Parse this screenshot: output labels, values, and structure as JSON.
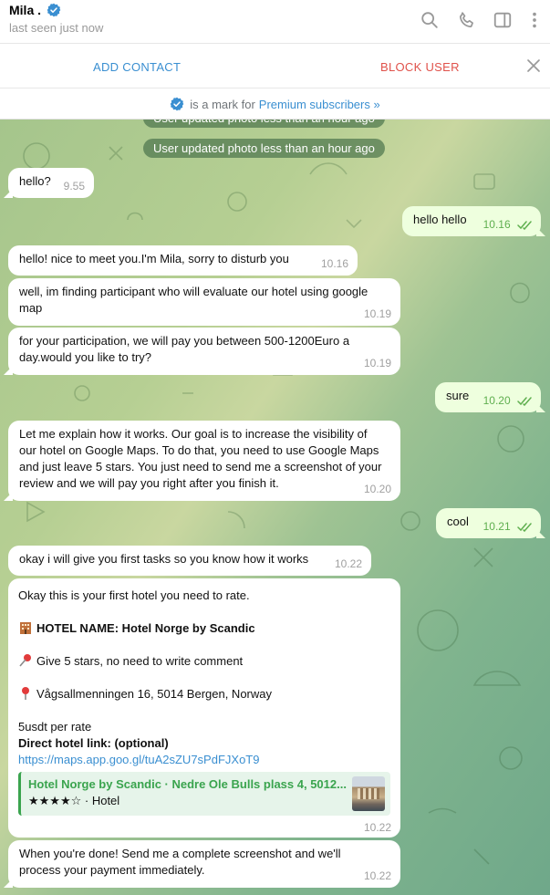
{
  "contact": {
    "name": "Mila .",
    "status": "last seen just now"
  },
  "header_icons": [
    "search-icon",
    "phone-icon",
    "sidebar-toggle-icon",
    "more-vertical-icon"
  ],
  "actions": {
    "add_contact": "ADD CONTACT",
    "block_user": "BLOCK USER"
  },
  "premium_bar": {
    "text": "is a mark for",
    "link": "Premium subscribers »"
  },
  "colors": {
    "accent": "#3a8fd1",
    "danger": "#e0524b",
    "outgoing_bubble": "#eeffde",
    "link_green": "#3aa44e"
  },
  "service_messages": {
    "partial": "User updated photo less than an hour ago",
    "photo_update": "User updated photo less than an hour ago"
  },
  "messages": [
    {
      "dir": "in",
      "text": "hello?",
      "time": "9.55"
    },
    {
      "dir": "out",
      "text": "hello hello",
      "time": "10.16"
    },
    {
      "dir": "in",
      "text": "hello! nice to meet you.I'm Mila, sorry to disturb  you",
      "time": "10.16"
    },
    {
      "dir": "in",
      "text": "well, im finding participant who will evaluate our hotel using google map",
      "time": "10.19"
    },
    {
      "dir": "in",
      "text": "for your participation, we will pay you between  500-1200Euro a day.would you like to try?",
      "time": "10.19"
    },
    {
      "dir": "out",
      "text": "sure",
      "time": "10.20"
    },
    {
      "dir": "in",
      "text": "Let me explain how it works. Our goal is to increase the visibility of our hotel on Google Maps. To do that, you need to use Google Maps and just leave 5 stars. You just need to send me a screenshot of your review and we will pay you right after you finish it.",
      "time": "10.20"
    },
    {
      "dir": "out",
      "text": "cool",
      "time": "10.21"
    },
    {
      "dir": "in",
      "text": "okay i will give you first tasks so you know how it works",
      "time": "10.22"
    }
  ],
  "hotel_task": {
    "intro": "Okay this is your first hotel you need to rate.",
    "hotel_name": "HOTEL NAME: Hotel Norge by Scandic",
    "stars_note": "Give 5 stars, no need to write comment",
    "address": "Vågsallmenningen 16, 5014 Bergen, Norway",
    "rate": "5usdt per rate",
    "link_label": "Direct hotel link: (optional)",
    "url": "https://maps.app.goo.gl/tuA2sZU7sPdFJXoT9",
    "preview_title": "Hotel Norge by Scandic · Nedre Ole Bulls plass 4, 5012...",
    "preview_sub": "★★★★☆ · Hotel",
    "time": "10.22"
  },
  "final_message": {
    "text": "When you're done! Send me a complete screenshot and we'll process your payment immediately.",
    "time": "10.22"
  }
}
